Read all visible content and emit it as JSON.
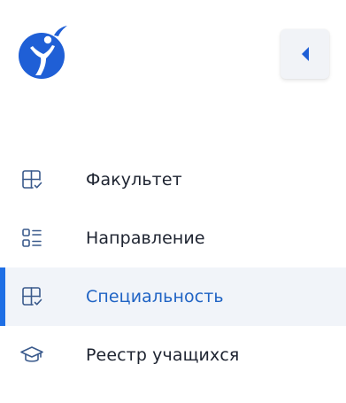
{
  "colors": {
    "accent": "#1f6fe5",
    "active_text": "#1f63c4",
    "active_bg": "#f1f4f9",
    "text": "#1d2330",
    "icon": "#3a5a8c"
  },
  "logo": {
    "icon": "runner-logo-icon"
  },
  "collapse_button": {
    "icon": "chevron-left-icon"
  },
  "menu": {
    "items": [
      {
        "label": "Факультет",
        "icon": "grid-check-icon",
        "active": false
      },
      {
        "label": "Направление",
        "icon": "list-icon",
        "active": false
      },
      {
        "label": "Специальность",
        "icon": "grid-check-icon",
        "active": true
      },
      {
        "label": "Реестр учащихся",
        "icon": "graduation-cap-icon",
        "active": false
      }
    ]
  }
}
